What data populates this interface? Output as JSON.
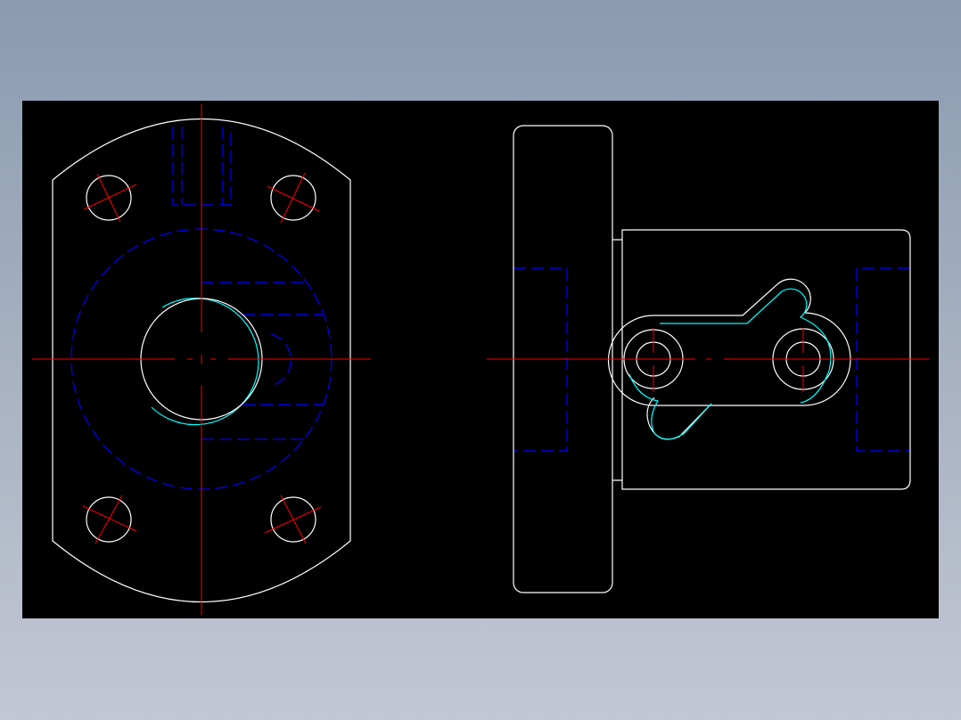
{
  "app": {
    "viewport_background_top": "#8a9bb0",
    "viewport_background_bottom": "#c3c7d3",
    "canvas_background": "#000000"
  },
  "layers": {
    "outline": {
      "color": "#ffffff",
      "linetype": "continuous"
    },
    "center": {
      "color": "#ff0000",
      "linetype": "center"
    },
    "hidden": {
      "color": "#0000ff",
      "linetype": "dashed"
    },
    "highlight": {
      "color": "#00ffff",
      "linetype": "continuous"
    }
  },
  "drawing": {
    "views": [
      "front-view",
      "side-view"
    ],
    "annotations": []
  }
}
